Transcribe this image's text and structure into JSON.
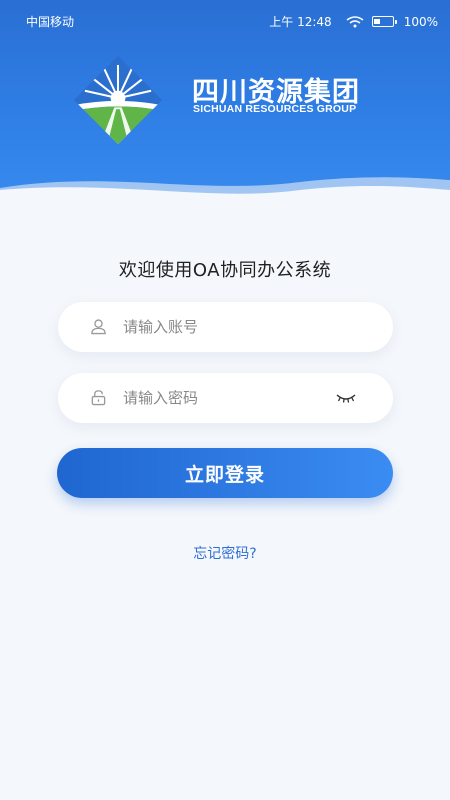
{
  "status_bar": {
    "carrier": "中国移动",
    "time": "上午 12:48",
    "battery": "100%"
  },
  "logo": {
    "name_cn": "四川资源集团",
    "name_en": "SICHUAN RESOURCES GROUP"
  },
  "welcome_text": "欢迎使用OA协同办公系统",
  "account_field": {
    "placeholder": "请输入账号",
    "value": "",
    "icon": "user-icon"
  },
  "password_field": {
    "placeholder": "请输入密码",
    "value": "",
    "icon": "lock-icon",
    "toggle_icon": "eye-closed-icon"
  },
  "login_button": "立即登录",
  "forgot_password": "忘记密码?",
  "colors": {
    "header": "#2f7fe6",
    "primary": "#1f66d0",
    "link": "#2f6fd4",
    "background": "#f4f7fb",
    "logo_green": "#4caf50",
    "logo_blue": "#1b5fb8"
  }
}
